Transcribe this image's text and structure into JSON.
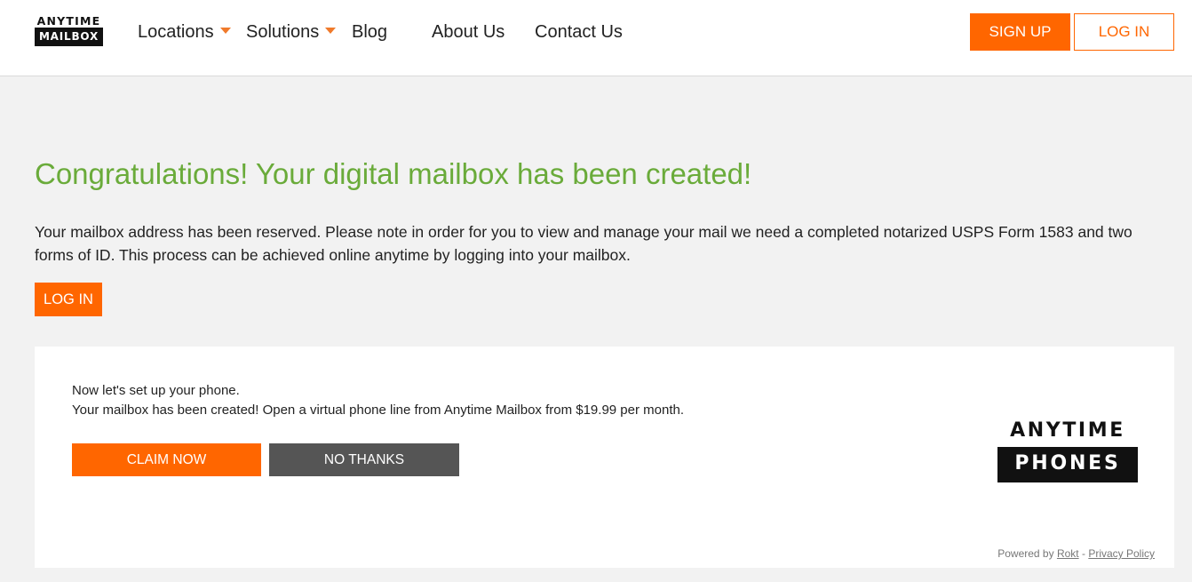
{
  "header": {
    "logo": {
      "top": "ANYTIME",
      "bottom": "MAILBOX"
    },
    "nav": [
      {
        "label": "Locations",
        "has_dropdown": true
      },
      {
        "label": "Solutions",
        "has_dropdown": true
      },
      {
        "label": "Blog",
        "has_dropdown": false
      },
      {
        "label": "About Us",
        "has_dropdown": false
      },
      {
        "label": "Contact Us",
        "has_dropdown": false
      }
    ],
    "signup_label": "SIGN UP",
    "login_label": "LOG IN"
  },
  "main": {
    "headline": "Congratulations! Your digital mailbox has been created!",
    "message": "Your mailbox address has been reserved. Please note in order for you to view and manage your mail we need a completed notarized USPS Form 1583 and two forms of ID. This process can be achieved online anytime by logging into your mailbox.",
    "login_label": "LOG IN"
  },
  "offer": {
    "line1": "Now let's set up your phone.",
    "line2": "Your mailbox has been created! Open a virtual phone line from Anytime Mailbox from $19.99 per month.",
    "claim_label": "CLAIM NOW",
    "decline_label": "NO THANKS",
    "logo": {
      "top": "ANYTIME",
      "bottom": "PHONES"
    },
    "powered_prefix": "Powered by",
    "powered_brand": "Rokt",
    "separator": "-",
    "privacy_label": "Privacy Policy"
  },
  "colors": {
    "accent": "#ff6600",
    "headline": "#6aab3a",
    "background": "#f2f2f2",
    "secondary_button": "#555555"
  }
}
